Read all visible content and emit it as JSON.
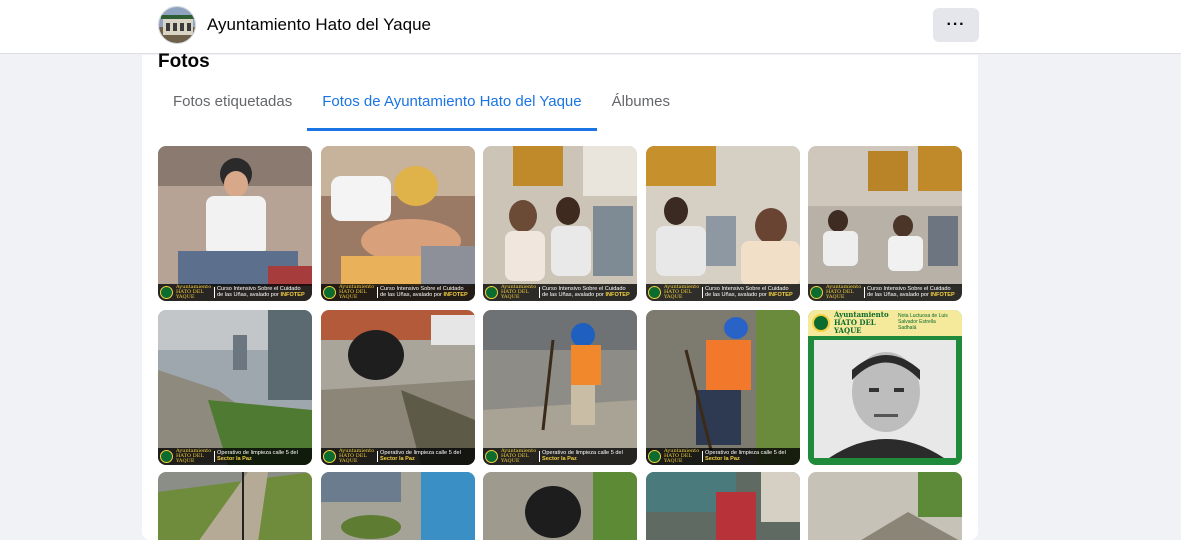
{
  "header": {
    "page_name": "Ayuntamiento Hato del Yaque",
    "more_label": "···"
  },
  "section": {
    "title": "Fotos",
    "tabs": [
      {
        "label": "Fotos etiquetadas",
        "active": false
      },
      {
        "label": "Fotos de Ayuntamiento Hato del Yaque",
        "active": true
      },
      {
        "label": "Álbumes",
        "active": false
      }
    ]
  },
  "photos": {
    "caption_brand": "Ayuntamiento HATO DEL YAQUE",
    "caption_nails_line1": "Curso Intensivo Sobre el Cuidado",
    "caption_nails_line2": "de las Uñas, avalado por",
    "caption_nails_highlight": "INFOTEP",
    "caption_street_line1": "Operativo de limpieza calle 5 del",
    "caption_street_highlight": "Sector la Paz",
    "necrology_brand": "Ayuntamiento HATO DEL YAQUE",
    "necrology_text": "Nota Luctuosa de Luis Salvador Estrella Sadhalá"
  },
  "colors": {
    "accent": "#1b74e4",
    "brand_green": "#0c6b2e",
    "brand_gold": "#f4d03f"
  }
}
